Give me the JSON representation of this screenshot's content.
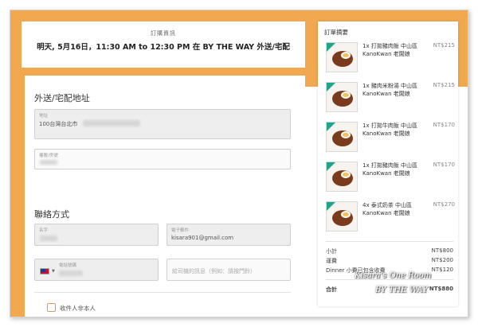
{
  "banner": {
    "title": "訂購資訊",
    "time": "明天, 5月16日，11:30 AM to 12:30 PM 在 BY THE WAY 外送/宅配"
  },
  "address": {
    "section_title": "外送/宅配地址",
    "address_label": "地址",
    "address_value": "100台灣台北市",
    "floor_label": "樓層/房號"
  },
  "contact": {
    "section_title": "聯絡方式",
    "name_label": "名字",
    "email_label": "電子郵件",
    "email_value": "kisara901@gmail.com",
    "phone_label": "電話號碼",
    "note_placeholder": "給司機的訊息（例如：請按門鈴）",
    "checkbox_label": "收件人非本人"
  },
  "summary": {
    "title": "訂單摘要",
    "items": [
      {
        "name": "1x 打拋豬肉飯 中山區 KanoKwan 老闆娘",
        "price": "NT$215"
      },
      {
        "name": "1x 豬肉米粉湯 中山區 KanoKwan 老闆娘",
        "price": "NT$215"
      },
      {
        "name": "1x 打拋牛肉飯 中山區 KanoKwan 老闆娘",
        "price": "NT$170"
      },
      {
        "name": "1x 打拋豬肉飯 中山區 KanoKwan 老闆娘",
        "price": "NT$170"
      },
      {
        "name": "4x 泰式奶茶 中山區 KanoKwan 老闆娘",
        "price": "NT$270"
      }
    ],
    "subtotal_label": "小計",
    "subtotal_value": "NT$800",
    "delivery_label": "運費",
    "delivery_value": "NT$200",
    "fee_label": "Dinner 小費已包含收費",
    "fee_value": "NT$120",
    "total_label": "合計",
    "total_value": "NT$880"
  },
  "watermark": {
    "line1": "Kisara's One Room",
    "line2": "BY THE WAY"
  },
  "colors": {
    "accent": "#f1a84e",
    "badge": "#1fa38a"
  }
}
